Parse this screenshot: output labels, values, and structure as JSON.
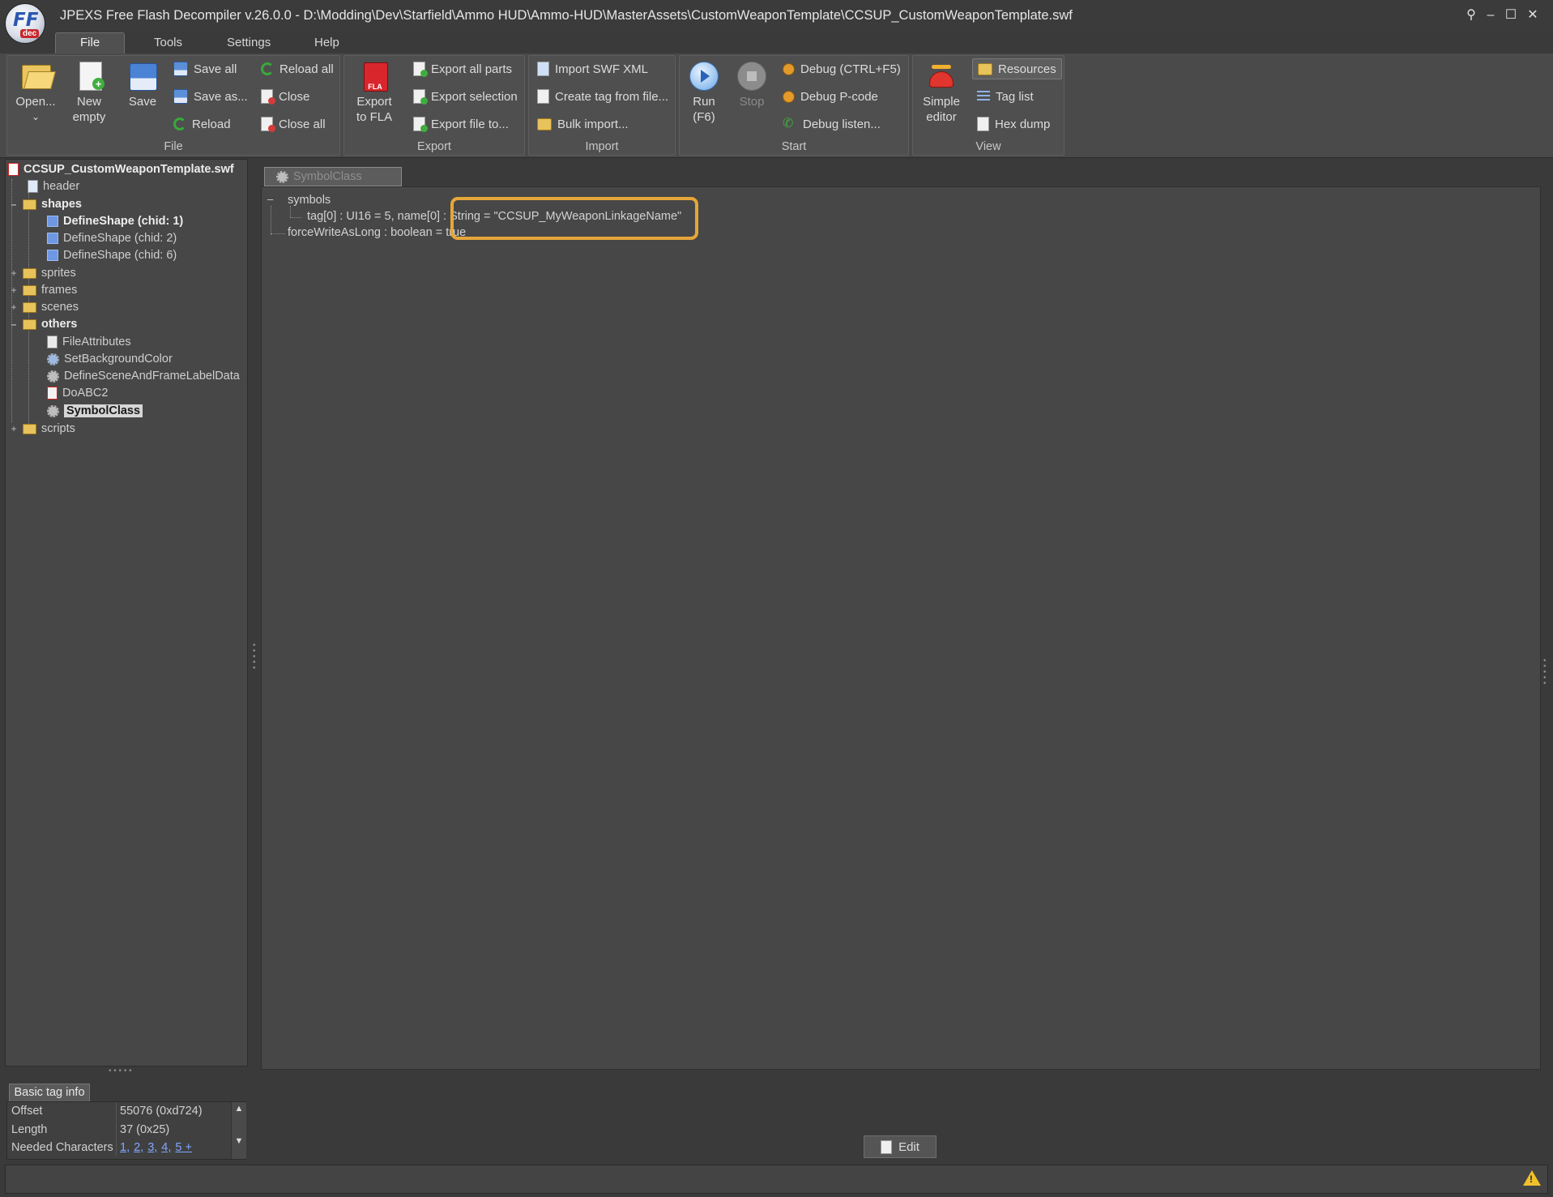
{
  "window": {
    "title": "JPEXS Free Flash Decompiler v.26.0.0 - D:\\Modding\\Dev\\Starfield\\Ammo HUD\\Ammo-HUD\\MasterAssets\\CustomWeaponTemplate\\CCSUP_CustomWeaponTemplate.swf",
    "logo_text": "FF",
    "logo_sub": "dec",
    "controls": {
      "pin": "⚲",
      "minimize": "–",
      "maximize": "☐",
      "close": "✕"
    }
  },
  "menu": {
    "tabs": [
      "File",
      "Tools",
      "Settings",
      "Help"
    ],
    "active": "File"
  },
  "ribbon": {
    "file": {
      "label": "File",
      "open": "Open...",
      "new_empty_1": "New",
      "new_empty_2": "empty",
      "save": "Save",
      "save_all": "Save all",
      "save_as": "Save as...",
      "reload": "Reload",
      "reload_all": "Reload all",
      "close": "Close",
      "close_all": "Close all"
    },
    "export": {
      "label": "Export",
      "export_fla_1": "Export",
      "export_fla_2": "to FLA",
      "fla_badge": "FLA",
      "export_all_parts": "Export all parts",
      "export_selection": "Export selection",
      "export_file_to": "Export file to..."
    },
    "import": {
      "label": "Import",
      "import_swf_xml": "Import SWF XML",
      "create_tag": "Create tag from file...",
      "bulk_import": "Bulk import..."
    },
    "start": {
      "label": "Start",
      "run_1": "Run",
      "run_2": "(F6)",
      "stop": "Stop",
      "debug": "Debug (CTRL+F5)",
      "debug_pcode": "Debug P-code",
      "debug_listen": "Debug listen..."
    },
    "view": {
      "label": "View",
      "simple_editor_1": "Simple",
      "simple_editor_2": "editor",
      "resources": "Resources",
      "tag_list": "Tag list",
      "hex_dump": "Hex dump"
    }
  },
  "tree": {
    "root": "CCSUP_CustomWeaponTemplate.swf",
    "header": "header",
    "shapes": "shapes",
    "shape_items": [
      "DefineShape (chid: 1)",
      "DefineShape (chid: 2)",
      "DefineShape (chid: 6)"
    ],
    "sprites": "sprites",
    "frames": "frames",
    "scenes": "scenes",
    "others": "others",
    "other_items": [
      "FileAttributes",
      "SetBackgroundColor",
      "DefineSceneAndFrameLabelData",
      "DoABC2",
      "SymbolClass"
    ],
    "scripts": "scripts",
    "selected": "SymbolClass"
  },
  "basic_tag_info": {
    "tab": "Basic tag info",
    "rows": [
      {
        "key": "Offset",
        "value": "55076 (0xd724)"
      },
      {
        "key": "Length",
        "value": "37 (0x25)"
      },
      {
        "key": "Needed Characters",
        "value": ""
      }
    ],
    "needed_links": [
      "1,",
      "2,",
      "3,",
      "4,",
      "5 +"
    ]
  },
  "editor": {
    "tab": "SymbolClass",
    "lines": {
      "symbols": "symbols",
      "tag_line": "tag[0] : UI16 = 5, name[0] : String = \"CCSUP_MyWeaponLinkageName\"",
      "force_line": "forceWriteAsLong : boolean = true"
    },
    "expander": "–",
    "edit_button": "Edit"
  },
  "status": {
    "warning": "!"
  },
  "colors": {
    "highlight": "#e6a63a",
    "background": "#474747",
    "link": "#7fa8ff"
  }
}
